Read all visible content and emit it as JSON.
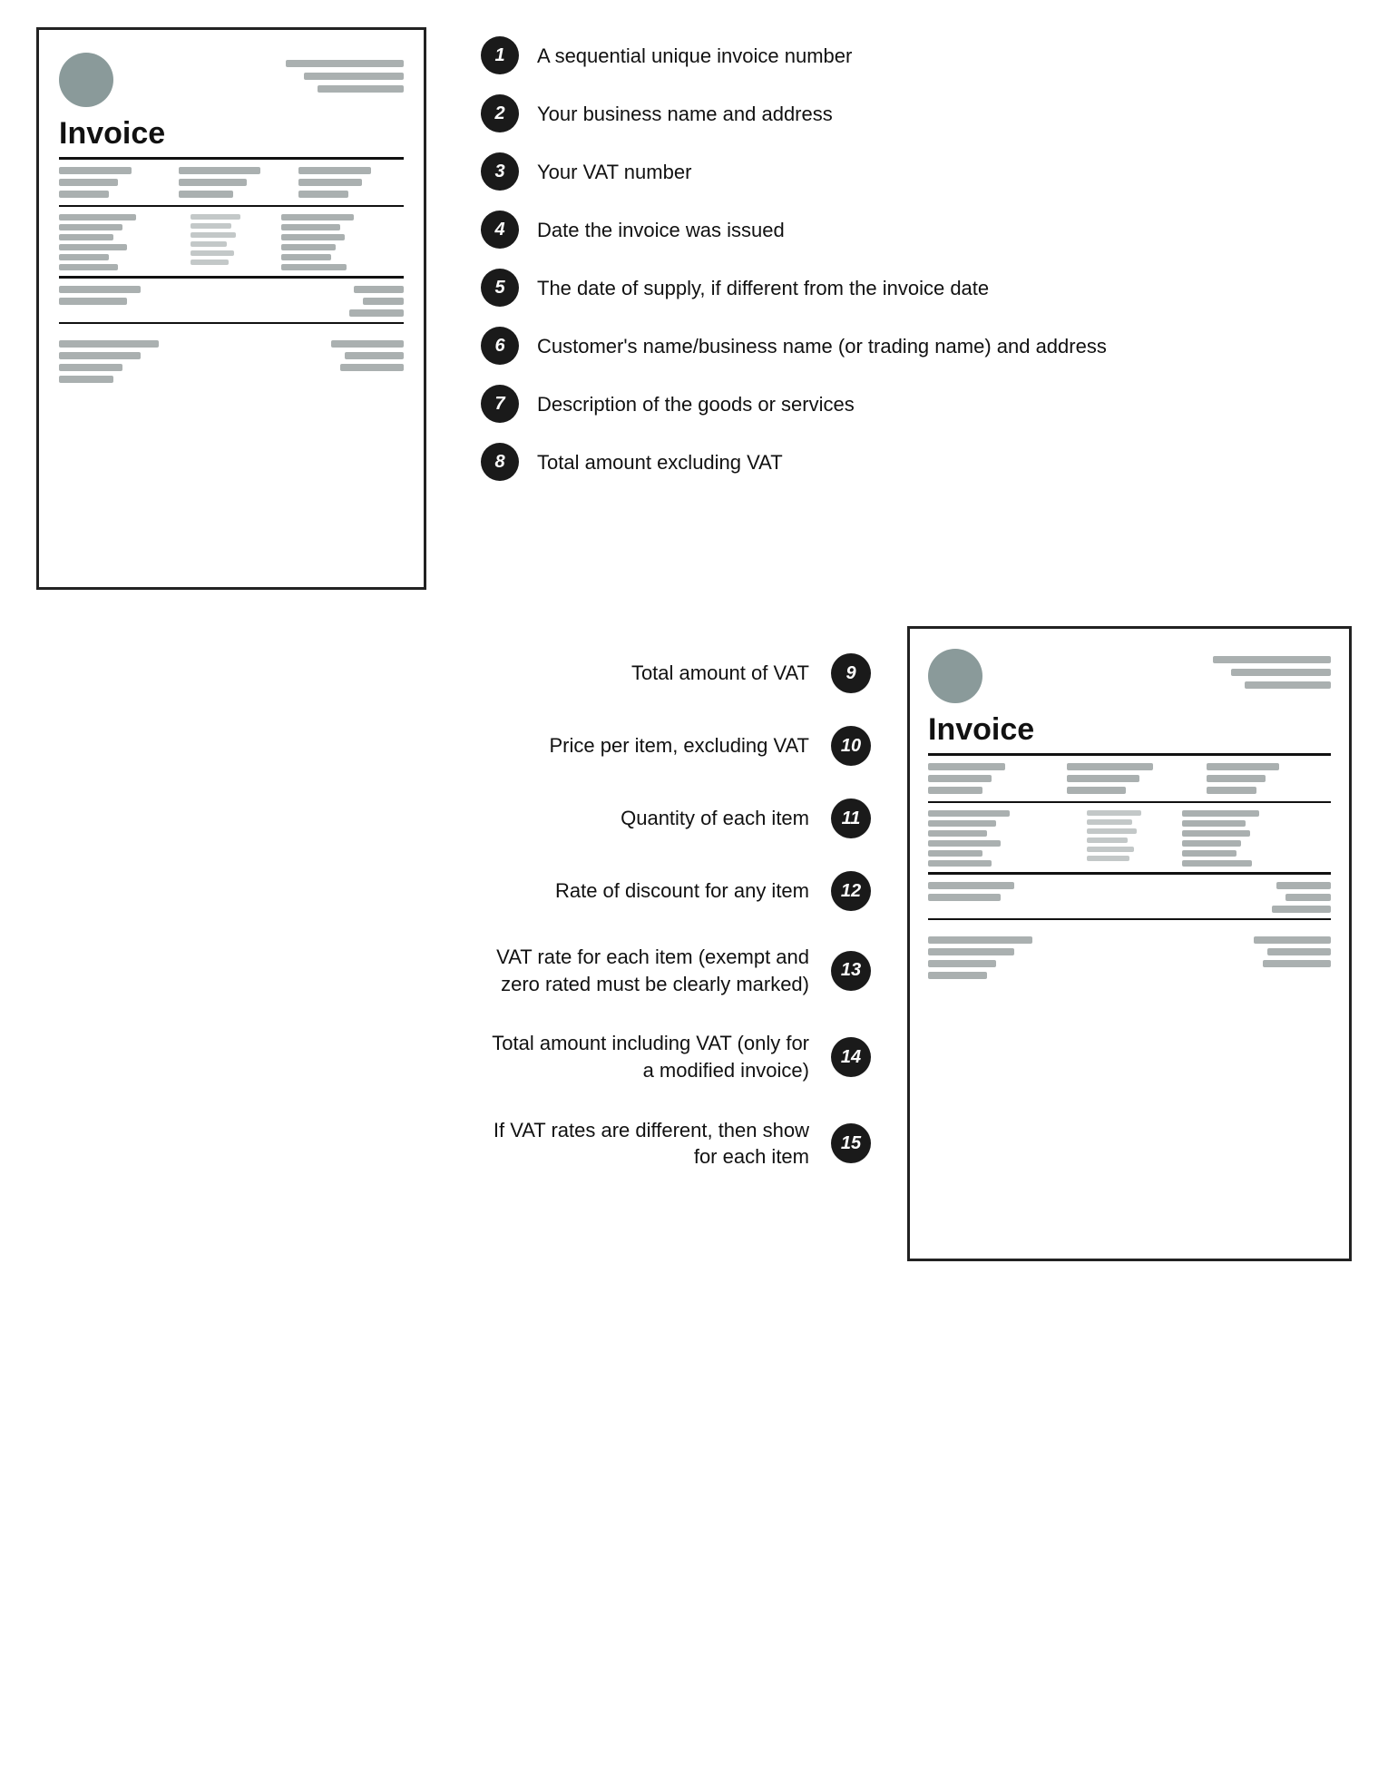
{
  "invoice_label": "Invoice",
  "items_top": [
    {
      "number": "1",
      "text": "A sequential unique invoice number"
    },
    {
      "number": "2",
      "text": "Your business name and address"
    },
    {
      "number": "3",
      "text": "Your VAT number"
    },
    {
      "number": "4",
      "text": "Date the invoice was issued"
    },
    {
      "number": "5",
      "text": "The date of supply, if different from the invoice date"
    },
    {
      "number": "6",
      "text": "Customer's name/business name (or trading name) and address"
    },
    {
      "number": "7",
      "text": "Description of the goods or services"
    },
    {
      "number": "8",
      "text": "Total amount excluding VAT"
    }
  ],
  "items_bottom": [
    {
      "number": "9",
      "text": "Total amount of VAT"
    },
    {
      "number": "10",
      "text": "Price per item, excluding VAT"
    },
    {
      "number": "11",
      "text": "Quantity of each item"
    },
    {
      "number": "12",
      "text": "Rate of discount for any item"
    },
    {
      "number": "13",
      "text": "VAT rate for each item (exempt and zero rated must be clearly marked)"
    },
    {
      "number": "14",
      "text": "Total amount including VAT (only for a modified invoice)"
    },
    {
      "number": "15",
      "text": "If VAT rates are different, then show for each item"
    }
  ]
}
